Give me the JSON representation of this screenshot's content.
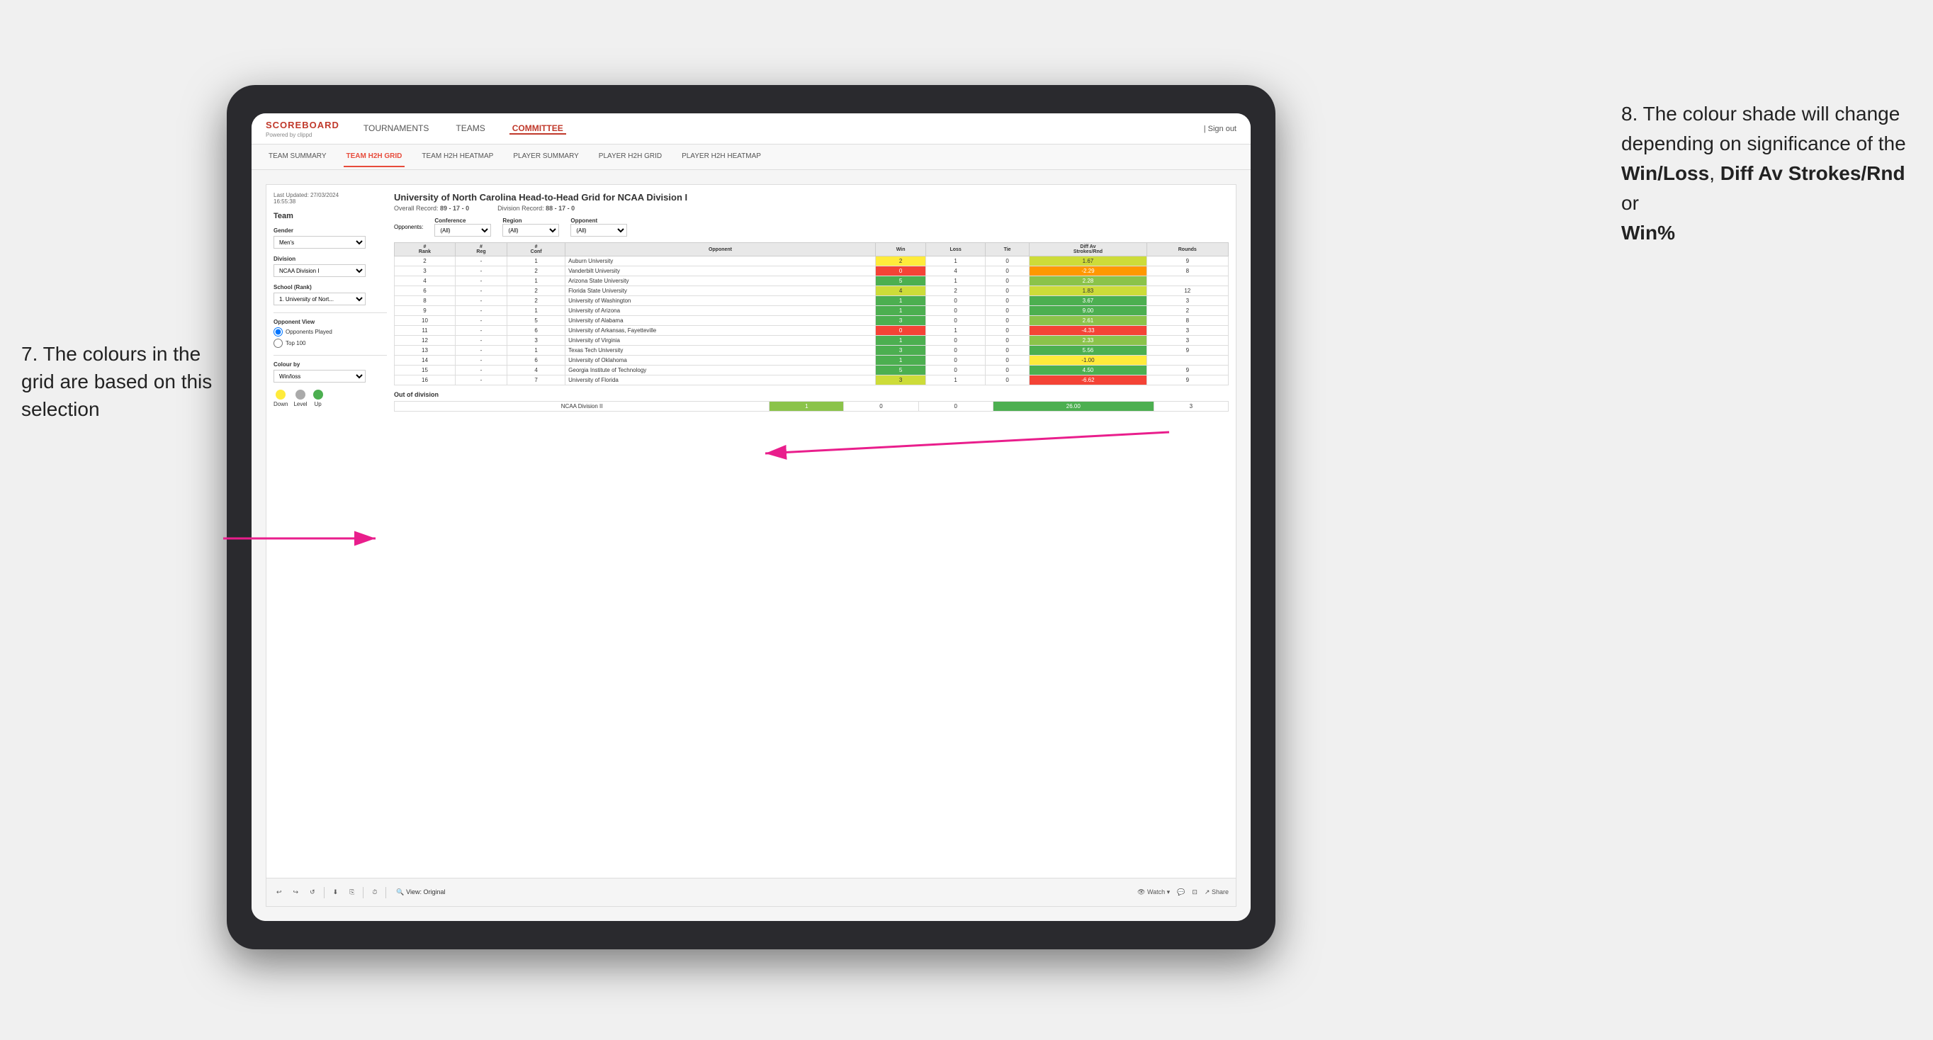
{
  "annotations": {
    "left_title": "7. The colours in the grid are based on this selection",
    "right_title": "8. The colour shade will change depending on significance of the",
    "right_bold1": "Win/Loss",
    "right_comma": ", ",
    "right_bold2": "Diff Av Strokes/Rnd",
    "right_or": " or",
    "right_bold3": "Win%"
  },
  "nav": {
    "logo": "SCOREBOARD",
    "logo_sub": "Powered by clippd",
    "links": [
      "TOURNAMENTS",
      "TEAMS",
      "COMMITTEE"
    ],
    "active_link": "COMMITTEE",
    "sign_out": "Sign out"
  },
  "sub_nav": {
    "links": [
      "TEAM SUMMARY",
      "TEAM H2H GRID",
      "TEAM H2H HEATMAP",
      "PLAYER SUMMARY",
      "PLAYER H2H GRID",
      "PLAYER H2H HEATMAP"
    ],
    "active": "TEAM H2H GRID"
  },
  "side_panel": {
    "timestamp": "Last Updated: 27/03/2024\n16:55:38",
    "team_label": "Team",
    "gender_label": "Gender",
    "gender_value": "Men's",
    "division_label": "Division",
    "division_value": "NCAA Division I",
    "school_label": "School (Rank)",
    "school_value": "1. University of Nort...",
    "opponent_view_label": "Opponent View",
    "radio_options": [
      "Opponents Played",
      "Top 100"
    ],
    "radio_selected": "Opponents Played",
    "colour_by_label": "Colour by",
    "colour_by_value": "Win/loss",
    "legend": {
      "down_label": "Down",
      "level_label": "Level",
      "up_label": "Up"
    }
  },
  "grid": {
    "title": "University of North Carolina Head-to-Head Grid for NCAA Division I",
    "overall_record_label": "Overall Record:",
    "overall_record_value": "89 - 17 - 0",
    "division_record_label": "Division Record:",
    "division_record_value": "88 - 17 - 0",
    "filters": {
      "conference_label": "Conference",
      "conference_value": "(All)",
      "region_label": "Region",
      "region_value": "(All)",
      "opponent_label": "Opponent",
      "opponent_value": "(All)",
      "opponents_label": "Opponents:"
    },
    "columns": [
      "#\nRank",
      "#\nReg",
      "#\nConf",
      "Opponent",
      "Win",
      "Loss",
      "Tie",
      "Diff Av\nStrokes/Rnd",
      "Rounds"
    ],
    "rows": [
      {
        "rank": "2",
        "reg": "-",
        "conf": "1",
        "opponent": "Auburn University",
        "win": "2",
        "loss": "1",
        "tie": "0",
        "diff": "1.67",
        "rounds": "9",
        "win_color": "yellow",
        "diff_color": "green_light"
      },
      {
        "rank": "3",
        "reg": "-",
        "conf": "2",
        "opponent": "Vanderbilt University",
        "win": "0",
        "loss": "4",
        "tie": "0",
        "diff": "-2.29",
        "rounds": "8",
        "win_color": "red",
        "diff_color": "orange"
      },
      {
        "rank": "4",
        "reg": "-",
        "conf": "1",
        "opponent": "Arizona State University",
        "win": "5",
        "loss": "1",
        "tie": "0",
        "diff": "2.28",
        "rounds": "",
        "win_color": "green_dark",
        "diff_color": "green_med"
      },
      {
        "rank": "6",
        "reg": "-",
        "conf": "2",
        "opponent": "Florida State University",
        "win": "4",
        "loss": "2",
        "tie": "0",
        "diff": "1.83",
        "rounds": "12",
        "win_color": "green_light",
        "diff_color": "green_light"
      },
      {
        "rank": "8",
        "reg": "-",
        "conf": "2",
        "opponent": "University of Washington",
        "win": "1",
        "loss": "0",
        "tie": "0",
        "diff": "3.67",
        "rounds": "3",
        "win_color": "green_dark",
        "diff_color": "green_dark"
      },
      {
        "rank": "9",
        "reg": "-",
        "conf": "1",
        "opponent": "University of Arizona",
        "win": "1",
        "loss": "0",
        "tie": "0",
        "diff": "9.00",
        "rounds": "2",
        "win_color": "green_dark",
        "diff_color": "green_dark"
      },
      {
        "rank": "10",
        "reg": "-",
        "conf": "5",
        "opponent": "University of Alabama",
        "win": "3",
        "loss": "0",
        "tie": "0",
        "diff": "2.61",
        "rounds": "8",
        "win_color": "green_dark",
        "diff_color": "green_med"
      },
      {
        "rank": "11",
        "reg": "-",
        "conf": "6",
        "opponent": "University of Arkansas, Fayetteville",
        "win": "0",
        "loss": "1",
        "tie": "0",
        "diff": "-4.33",
        "rounds": "3",
        "win_color": "red",
        "diff_color": "red"
      },
      {
        "rank": "12",
        "reg": "-",
        "conf": "3",
        "opponent": "University of Virginia",
        "win": "1",
        "loss": "0",
        "tie": "0",
        "diff": "2.33",
        "rounds": "3",
        "win_color": "green_dark",
        "diff_color": "green_med"
      },
      {
        "rank": "13",
        "reg": "-",
        "conf": "1",
        "opponent": "Texas Tech University",
        "win": "3",
        "loss": "0",
        "tie": "0",
        "diff": "5.56",
        "rounds": "9",
        "win_color": "green_dark",
        "diff_color": "green_dark"
      },
      {
        "rank": "14",
        "reg": "-",
        "conf": "6",
        "opponent": "University of Oklahoma",
        "win": "1",
        "loss": "0",
        "tie": "0",
        "diff": "-1.00",
        "rounds": "",
        "win_color": "green_dark",
        "diff_color": "yellow"
      },
      {
        "rank": "15",
        "reg": "-",
        "conf": "4",
        "opponent": "Georgia Institute of Technology",
        "win": "5",
        "loss": "0",
        "tie": "0",
        "diff": "4.50",
        "rounds": "9",
        "win_color": "green_dark",
        "diff_color": "green_dark"
      },
      {
        "rank": "16",
        "reg": "-",
        "conf": "7",
        "opponent": "University of Florida",
        "win": "3",
        "loss": "1",
        "tie": "0",
        "diff": "-6.62",
        "rounds": "9",
        "win_color": "green_light",
        "diff_color": "red"
      }
    ],
    "out_of_division_label": "Out of division",
    "out_division_rows": [
      {
        "division": "NCAA Division II",
        "win": "1",
        "loss": "0",
        "tie": "0",
        "diff": "26.00",
        "rounds": "3",
        "diff_color": "green_dark"
      }
    ]
  },
  "toolbar": {
    "view_label": "View: Original",
    "watch_label": "Watch",
    "share_label": "Share"
  }
}
